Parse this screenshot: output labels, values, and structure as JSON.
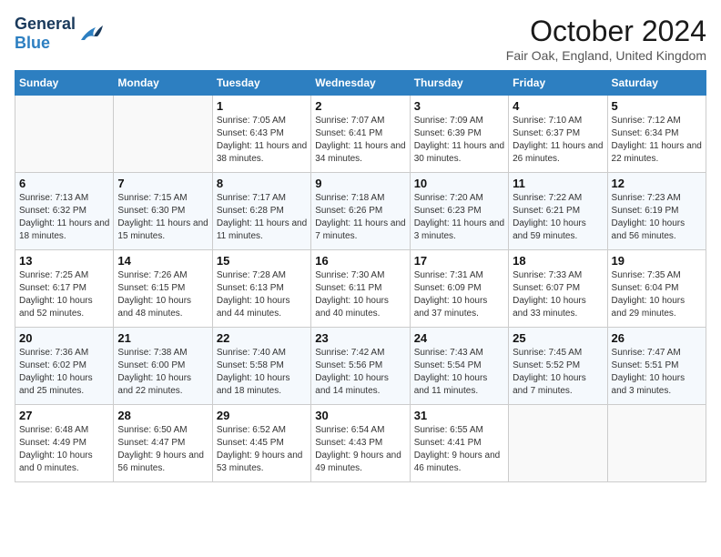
{
  "header": {
    "logo_general": "General",
    "logo_blue": "Blue",
    "month_title": "October 2024",
    "location": "Fair Oak, England, United Kingdom"
  },
  "weekdays": [
    "Sunday",
    "Monday",
    "Tuesday",
    "Wednesday",
    "Thursday",
    "Friday",
    "Saturday"
  ],
  "weeks": [
    [
      {
        "day": "",
        "empty": true
      },
      {
        "day": "",
        "empty": true
      },
      {
        "day": "1",
        "sunrise": "Sunrise: 7:05 AM",
        "sunset": "Sunset: 6:43 PM",
        "daylight": "Daylight: 11 hours and 38 minutes."
      },
      {
        "day": "2",
        "sunrise": "Sunrise: 7:07 AM",
        "sunset": "Sunset: 6:41 PM",
        "daylight": "Daylight: 11 hours and 34 minutes."
      },
      {
        "day": "3",
        "sunrise": "Sunrise: 7:09 AM",
        "sunset": "Sunset: 6:39 PM",
        "daylight": "Daylight: 11 hours and 30 minutes."
      },
      {
        "day": "4",
        "sunrise": "Sunrise: 7:10 AM",
        "sunset": "Sunset: 6:37 PM",
        "daylight": "Daylight: 11 hours and 26 minutes."
      },
      {
        "day": "5",
        "sunrise": "Sunrise: 7:12 AM",
        "sunset": "Sunset: 6:34 PM",
        "daylight": "Daylight: 11 hours and 22 minutes."
      }
    ],
    [
      {
        "day": "6",
        "sunrise": "Sunrise: 7:13 AM",
        "sunset": "Sunset: 6:32 PM",
        "daylight": "Daylight: 11 hours and 18 minutes."
      },
      {
        "day": "7",
        "sunrise": "Sunrise: 7:15 AM",
        "sunset": "Sunset: 6:30 PM",
        "daylight": "Daylight: 11 hours and 15 minutes."
      },
      {
        "day": "8",
        "sunrise": "Sunrise: 7:17 AM",
        "sunset": "Sunset: 6:28 PM",
        "daylight": "Daylight: 11 hours and 11 minutes."
      },
      {
        "day": "9",
        "sunrise": "Sunrise: 7:18 AM",
        "sunset": "Sunset: 6:26 PM",
        "daylight": "Daylight: 11 hours and 7 minutes."
      },
      {
        "day": "10",
        "sunrise": "Sunrise: 7:20 AM",
        "sunset": "Sunset: 6:23 PM",
        "daylight": "Daylight: 11 hours and 3 minutes."
      },
      {
        "day": "11",
        "sunrise": "Sunrise: 7:22 AM",
        "sunset": "Sunset: 6:21 PM",
        "daylight": "Daylight: 10 hours and 59 minutes."
      },
      {
        "day": "12",
        "sunrise": "Sunrise: 7:23 AM",
        "sunset": "Sunset: 6:19 PM",
        "daylight": "Daylight: 10 hours and 56 minutes."
      }
    ],
    [
      {
        "day": "13",
        "sunrise": "Sunrise: 7:25 AM",
        "sunset": "Sunset: 6:17 PM",
        "daylight": "Daylight: 10 hours and 52 minutes."
      },
      {
        "day": "14",
        "sunrise": "Sunrise: 7:26 AM",
        "sunset": "Sunset: 6:15 PM",
        "daylight": "Daylight: 10 hours and 48 minutes."
      },
      {
        "day": "15",
        "sunrise": "Sunrise: 7:28 AM",
        "sunset": "Sunset: 6:13 PM",
        "daylight": "Daylight: 10 hours and 44 minutes."
      },
      {
        "day": "16",
        "sunrise": "Sunrise: 7:30 AM",
        "sunset": "Sunset: 6:11 PM",
        "daylight": "Daylight: 10 hours and 40 minutes."
      },
      {
        "day": "17",
        "sunrise": "Sunrise: 7:31 AM",
        "sunset": "Sunset: 6:09 PM",
        "daylight": "Daylight: 10 hours and 37 minutes."
      },
      {
        "day": "18",
        "sunrise": "Sunrise: 7:33 AM",
        "sunset": "Sunset: 6:07 PM",
        "daylight": "Daylight: 10 hours and 33 minutes."
      },
      {
        "day": "19",
        "sunrise": "Sunrise: 7:35 AM",
        "sunset": "Sunset: 6:04 PM",
        "daylight": "Daylight: 10 hours and 29 minutes."
      }
    ],
    [
      {
        "day": "20",
        "sunrise": "Sunrise: 7:36 AM",
        "sunset": "Sunset: 6:02 PM",
        "daylight": "Daylight: 10 hours and 25 minutes."
      },
      {
        "day": "21",
        "sunrise": "Sunrise: 7:38 AM",
        "sunset": "Sunset: 6:00 PM",
        "daylight": "Daylight: 10 hours and 22 minutes."
      },
      {
        "day": "22",
        "sunrise": "Sunrise: 7:40 AM",
        "sunset": "Sunset: 5:58 PM",
        "daylight": "Daylight: 10 hours and 18 minutes."
      },
      {
        "day": "23",
        "sunrise": "Sunrise: 7:42 AM",
        "sunset": "Sunset: 5:56 PM",
        "daylight": "Daylight: 10 hours and 14 minutes."
      },
      {
        "day": "24",
        "sunrise": "Sunrise: 7:43 AM",
        "sunset": "Sunset: 5:54 PM",
        "daylight": "Daylight: 10 hours and 11 minutes."
      },
      {
        "day": "25",
        "sunrise": "Sunrise: 7:45 AM",
        "sunset": "Sunset: 5:52 PM",
        "daylight": "Daylight: 10 hours and 7 minutes."
      },
      {
        "day": "26",
        "sunrise": "Sunrise: 7:47 AM",
        "sunset": "Sunset: 5:51 PM",
        "daylight": "Daylight: 10 hours and 3 minutes."
      }
    ],
    [
      {
        "day": "27",
        "sunrise": "Sunrise: 6:48 AM",
        "sunset": "Sunset: 4:49 PM",
        "daylight": "Daylight: 10 hours and 0 minutes."
      },
      {
        "day": "28",
        "sunrise": "Sunrise: 6:50 AM",
        "sunset": "Sunset: 4:47 PM",
        "daylight": "Daylight: 9 hours and 56 minutes."
      },
      {
        "day": "29",
        "sunrise": "Sunrise: 6:52 AM",
        "sunset": "Sunset: 4:45 PM",
        "daylight": "Daylight: 9 hours and 53 minutes."
      },
      {
        "day": "30",
        "sunrise": "Sunrise: 6:54 AM",
        "sunset": "Sunset: 4:43 PM",
        "daylight": "Daylight: 9 hours and 49 minutes."
      },
      {
        "day": "31",
        "sunrise": "Sunrise: 6:55 AM",
        "sunset": "Sunset: 4:41 PM",
        "daylight": "Daylight: 9 hours and 46 minutes."
      },
      {
        "day": "",
        "empty": true
      },
      {
        "day": "",
        "empty": true
      }
    ]
  ]
}
